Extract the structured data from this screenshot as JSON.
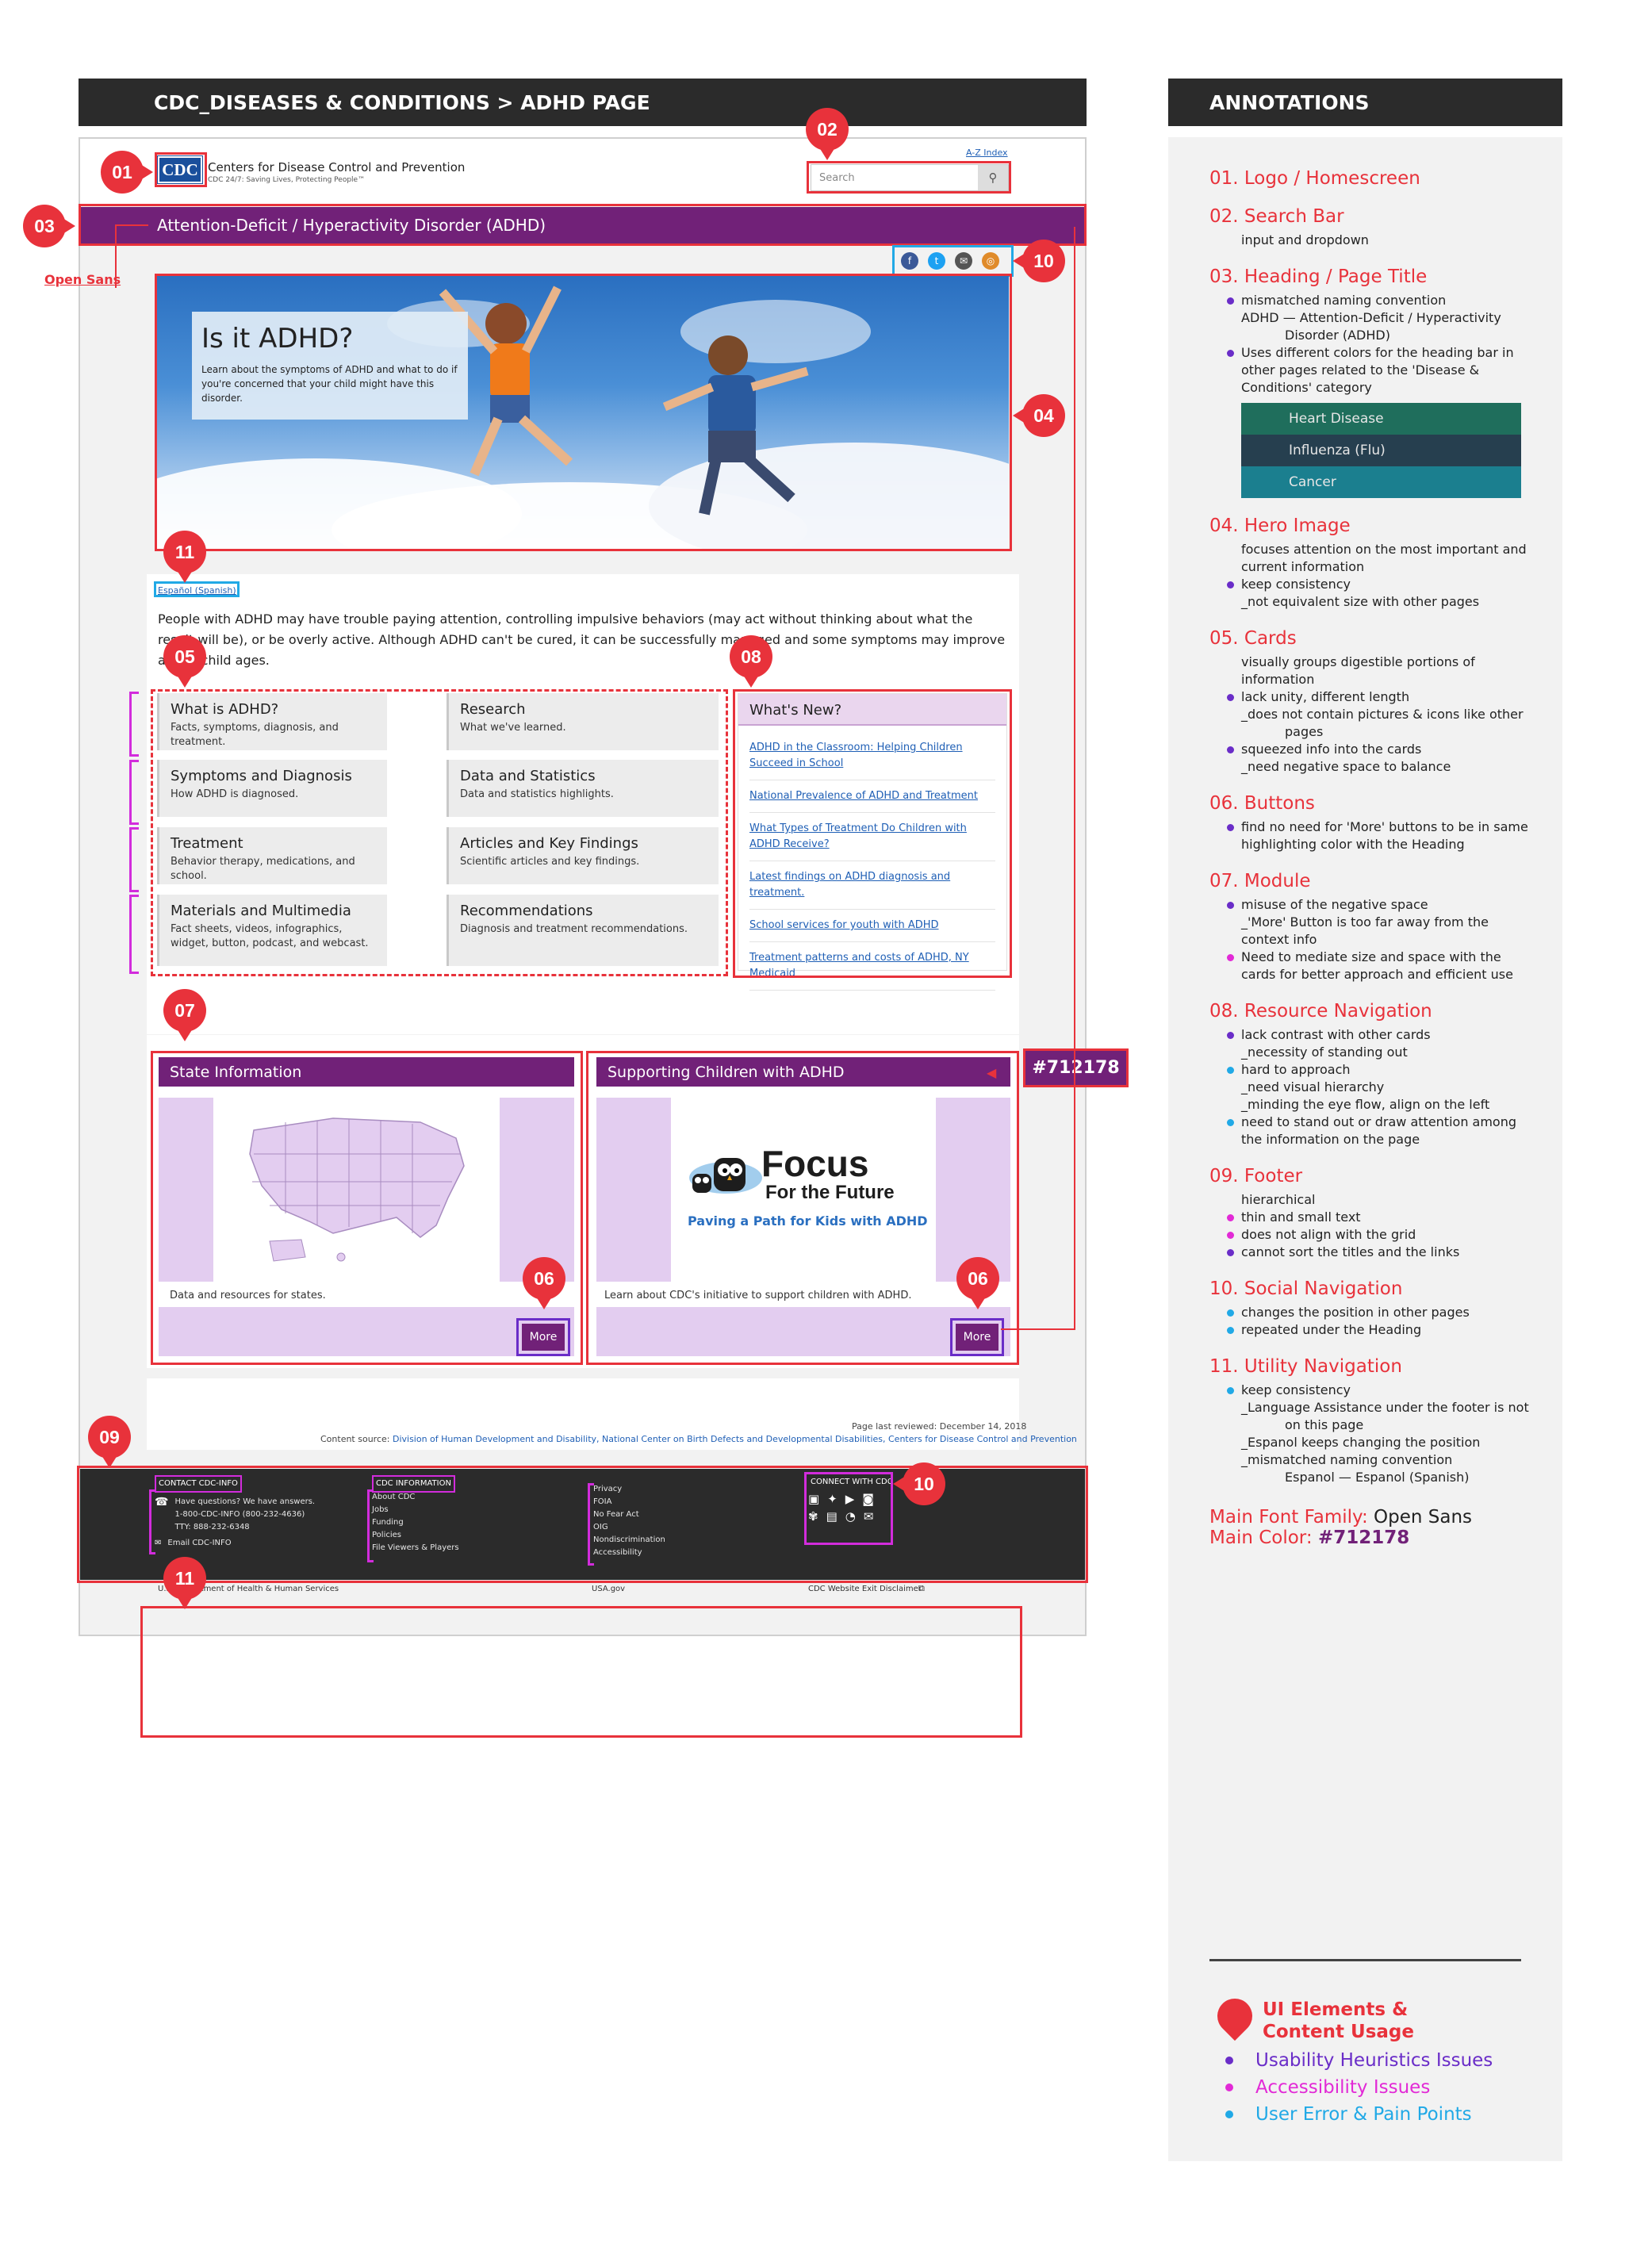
{
  "left_header": "CDC_DISEASES & CONDITIONS > ADHD PAGE",
  "right_header": "ANNOTATIONS",
  "pins": {
    "p01": "01",
    "p02": "02",
    "p03": "03",
    "p04": "04",
    "p05": "05",
    "p06": "06",
    "p07": "07",
    "p08": "08",
    "p09": "09",
    "p10": "10",
    "p11": "11"
  },
  "open_sans_label": "Open Sans",
  "color_tag": "#712178",
  "site": {
    "logo_text": "CDC",
    "org_name": "Centers for Disease Control and Prevention",
    "tagline": "CDC 24/7: Saving Lives, Protecting People™",
    "az_index": "A-Z Index",
    "search_placeholder": "Search",
    "page_title": "Attention-Deficit / Hyperactivity Disorder (ADHD)",
    "hero_title": "Is it ADHD?",
    "hero_text": "Learn about the symptoms of ADHD and what to do if you're concerned that your child might have this disorder.",
    "spanish_link": "Español (Spanish)",
    "intro": "People with ADHD may have trouble paying attention, controlling impulsive behaviors (may act without thinking about what the result will be), or be overly active. Although ADHD can't be cured, it can be successfully managed and some symptoms may improve as the child ages.",
    "cards": [
      {
        "title": "What is ADHD?",
        "desc": "Facts, symptoms, diagnosis, and treatment."
      },
      {
        "title": "Research",
        "desc": "What we've learned."
      },
      {
        "title": "Symptoms and Diagnosis",
        "desc": "How ADHD is diagnosed."
      },
      {
        "title": "Data and Statistics",
        "desc": "Data and statistics highlights."
      },
      {
        "title": "Treatment",
        "desc": "Behavior therapy, medications, and school."
      },
      {
        "title": "Articles and Key Findings",
        "desc": "Scientific articles and key findings."
      },
      {
        "title": "Materials and Multimedia",
        "desc": "Fact sheets, videos, infographics, widget, button, podcast, and webcast."
      },
      {
        "title": "Recommendations",
        "desc": "Diagnosis and treatment recommendations."
      }
    ],
    "whats_new_title": "What's New?",
    "whats_new": [
      "ADHD in the Classroom: Helping Children Succeed in School",
      "National Prevalence of ADHD and Treatment",
      "What Types of Treatment Do Children with ADHD Receive?",
      "Latest findings on ADHD diagnosis and treatment.",
      "School services for youth with ADHD",
      "Treatment patterns and costs of ADHD, NY Medicaid"
    ],
    "module_state": {
      "title": "State Information",
      "caption": "Data and resources for states.",
      "button": "More"
    },
    "module_support": {
      "title": "Supporting Children with ADHD",
      "caption": "Learn about CDC's initiative to support children with ADHD.",
      "button": "More",
      "focus_word": "Focus",
      "focus_sub": "For the Future",
      "focus_tag": "Paving a Path for Kids with ADHD"
    },
    "last_reviewed": "Page last reviewed: December 14, 2018",
    "content_source_label": "Content source:",
    "content_source": "Division of Human Development and Disability, National Center on Birth Defects and Developmental Disabilities, Centers for Disease Control and Prevention",
    "footer": {
      "contact_title": "CONTACT CDC-INFO",
      "contact_lines": [
        "Have questions? We have answers.",
        "1-800-CDC-INFO (800-232-4636)",
        "TTY: 888-232-6348"
      ],
      "email": "Email CDC-INFO",
      "info_title": "CDC INFORMATION",
      "info_links": [
        "About CDC",
        "Jobs",
        "Funding",
        "Policies",
        "File Viewers & Players"
      ],
      "more_links": [
        "Privacy",
        "FOIA",
        "No Fear Act",
        "OIG",
        "Nondiscrimination",
        "Accessibility"
      ],
      "connect_title": "CONNECT WITH CDC"
    },
    "bottom": {
      "hhs": "U.S. Department of Health & Human Services",
      "usa": "USA.gov",
      "exit": "CDC Website Exit Disclaimer"
    }
  },
  "annotations": [
    {
      "title": "01. Logo / Homescreen",
      "notes": []
    },
    {
      "title": "02. Search Bar",
      "notes": [
        {
          "text": "input and dropdown",
          "dot": ""
        }
      ]
    },
    {
      "title": "03. Heading / Page Title",
      "notes": [
        {
          "text": "mismatched naming convention",
          "dot": "#6a2dc8"
        },
        {
          "text": "ADHD — Attention-Deficit / Hyperactivity",
          "dot": ""
        },
        {
          "text": "Disorder (ADHD)",
          "dot": "",
          "indent": true
        },
        {
          "text": "Uses different colors for the heading bar in",
          "dot": "#6a2dc8"
        },
        {
          "text": "other pages related to the 'Disease &",
          "dot": ""
        },
        {
          "text": "Conditions' category",
          "dot": ""
        }
      ]
    },
    {
      "title": "04. Hero Image",
      "notes": [
        {
          "text": "focuses attention on the most important and",
          "dot": ""
        },
        {
          "text": "current information",
          "dot": ""
        },
        {
          "text": "keep consistency",
          "dot": "#6a2dc8"
        },
        {
          "text": "_not equivalent size with other pages",
          "dot": ""
        }
      ]
    },
    {
      "title": "05. Cards",
      "notes": [
        {
          "text": "visually groups digestible portions of",
          "dot": ""
        },
        {
          "text": "information",
          "dot": ""
        },
        {
          "text": "lack unity, different length",
          "dot": "#6a2dc8"
        },
        {
          "text": "_does not contain pictures & icons like other",
          "dot": ""
        },
        {
          "text": "pages",
          "dot": "",
          "indent": true
        },
        {
          "text": "squeezed info into the cards",
          "dot": "#6a2dc8"
        },
        {
          "text": "_need negative space to balance",
          "dot": ""
        }
      ]
    },
    {
      "title": "06. Buttons",
      "notes": [
        {
          "text": "find no need for 'More' buttons to be in same",
          "dot": "#6a2dc8"
        },
        {
          "text": "highlighting color with the Heading",
          "dot": ""
        }
      ]
    },
    {
      "title": "07. Module",
      "notes": [
        {
          "text": "misuse of the negative space",
          "dot": "#6a2dc8"
        },
        {
          "text": "_'More' Button is too far away from the",
          "dot": ""
        },
        {
          "text": "context info",
          "dot": ""
        },
        {
          "text": "Need to mediate size and space with the",
          "dot": "#e22ad6"
        },
        {
          "text": "cards for better approach and efficient use",
          "dot": ""
        }
      ]
    },
    {
      "title": "08. Resource Navigation",
      "notes": [
        {
          "text": "lack contrast with other cards",
          "dot": "#6a2dc8"
        },
        {
          "text": "_necessity of standing out",
          "dot": ""
        },
        {
          "text": "hard to approach",
          "dot": "#21a9e6"
        },
        {
          "text": "_need visual hierarchy",
          "dot": ""
        },
        {
          "text": "_minding the eye flow, align on the left",
          "dot": ""
        },
        {
          "text": "need to stand out or draw attention among",
          "dot": "#21a9e6"
        },
        {
          "text": "the information on the page",
          "dot": ""
        }
      ]
    },
    {
      "title": "09. Footer",
      "notes": [
        {
          "text": "hierarchical",
          "dot": ""
        },
        {
          "text": "thin and small text",
          "dot": "#e22ad6"
        },
        {
          "text": "does not align with the grid",
          "dot": "#e22ad6"
        },
        {
          "text": "cannot sort the titles and the links",
          "dot": "#6a2dc8"
        }
      ]
    },
    {
      "title": "10. Social Navigation",
      "notes": [
        {
          "text": "changes the position in other pages",
          "dot": "#21a9e6"
        },
        {
          "text": "repeated under the Heading",
          "dot": "#21a9e6"
        }
      ]
    },
    {
      "title": "11. Utility Navigation",
      "notes": [
        {
          "text": "keep consistency",
          "dot": "#21a9e6"
        },
        {
          "text": "_Language Assistance under the footer is not",
          "dot": ""
        },
        {
          "text": "on this page",
          "dot": "",
          "indent": true
        },
        {
          "text": "_Espanol keeps changing the position",
          "dot": ""
        },
        {
          "text": "_mismatched naming convention",
          "dot": ""
        },
        {
          "text": "Espanol — Espanol (Spanish)",
          "dot": "",
          "indent": true
        }
      ]
    }
  ],
  "heading_swatches": [
    "Heart Disease",
    "Influenza (Flu)",
    "Cancer"
  ],
  "font_label": "Main Font Family:",
  "font_value": "Open Sans",
  "color_label": "Main Color:",
  "color_value": "#712178",
  "legend": {
    "title_line1": "UI Elements &",
    "title_line2": "Content Usage",
    "items": [
      {
        "text": "Usability Heuristics Issues",
        "color": "#6a2dc8"
      },
      {
        "text": "Accessibility Issues",
        "color": "#e22ad6"
      },
      {
        "text": "User Error & Pain Points",
        "color": "#21a9e6"
      }
    ]
  },
  "colors": {
    "brand": "#712178",
    "annotation_red": "#e8323b",
    "heading_bar": "#2b2b2b"
  }
}
